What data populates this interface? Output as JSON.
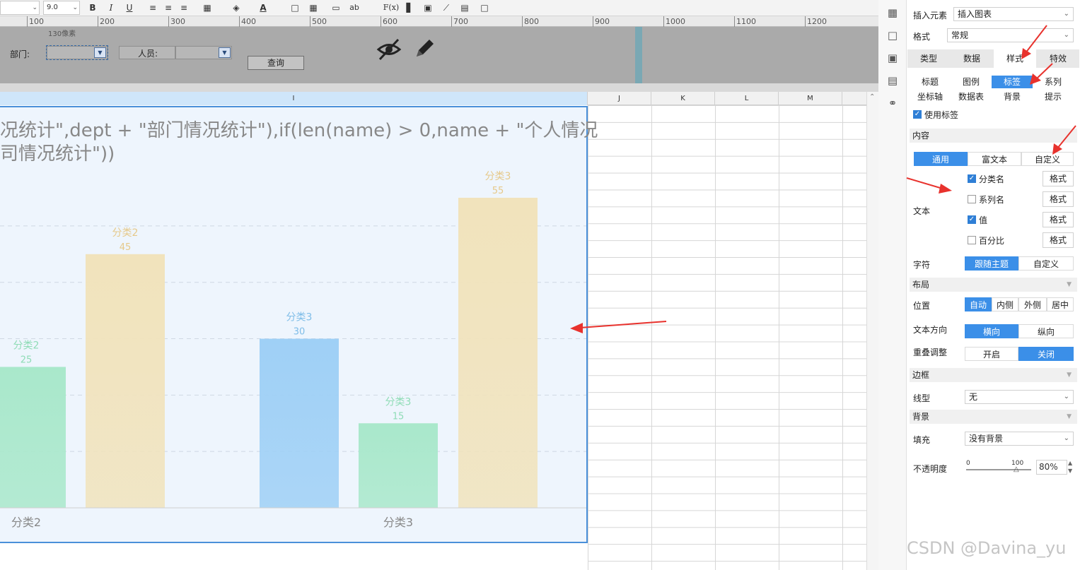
{
  "toolbar": {
    "font_size": "9.0",
    "bold": "B",
    "italic": "I",
    "underline": "U",
    "formula": "F(x)",
    "ab": "ab"
  },
  "ruler": {
    "labels": [
      "100",
      "200",
      "300",
      "400",
      "500",
      "600",
      "700",
      "800",
      "900",
      "1000",
      "1100",
      "1200"
    ],
    "pixel_hint": "130像素"
  },
  "param_panel": {
    "dept_label": "部门:",
    "person_label": "人员:",
    "query_button": "查询"
  },
  "columns": [
    "I",
    "J",
    "K",
    "L",
    "M"
  ],
  "chart": {
    "title_line1": "况统计\",dept + \"部门情况统计\"),if(len(name) > 0,name + \"个人情况",
    "title_line2": "司情况统计\"))"
  },
  "chart_data": {
    "type": "bar",
    "categories": [
      "分类2",
      "分类3"
    ],
    "ylim": [
      0,
      55
    ],
    "bars": [
      {
        "group": "分类2",
        "label": "分类2",
        "value": 25,
        "color": "#a9e8cb"
      },
      {
        "group": "分类2",
        "label": "分类2",
        "value": 45,
        "color": "#f1e3bc"
      },
      {
        "group": "分类3",
        "label": "分类3",
        "value": 30,
        "color": "#9fd0f6"
      },
      {
        "group": "分类3",
        "label": "分类3",
        "value": 15,
        "color": "#a9e8cb"
      },
      {
        "group": "分类3",
        "label": "分类3",
        "value": 55,
        "color": "#f1e3bc"
      }
    ]
  },
  "right_panel": {
    "insert_label": "插入元素",
    "insert_value": "插入图表",
    "format_label": "格式",
    "format_value": "常规",
    "tabs": [
      "类型",
      "数据",
      "样式",
      "特效"
    ],
    "subtabs_row1": [
      "标题",
      "图例",
      "标签",
      "系列"
    ],
    "subtabs_row2": [
      "坐标轴",
      "数据表",
      "背景",
      "提示"
    ],
    "use_label": "使用标签",
    "content_section": "内容",
    "content_modes": [
      "通用",
      "富文本",
      "自定义"
    ],
    "text_label": "文本",
    "text_options": [
      {
        "label": "分类名",
        "checked": true,
        "button": "格式"
      },
      {
        "label": "系列名",
        "checked": false,
        "button": "格式"
      },
      {
        "label": "值",
        "checked": true,
        "button": "格式"
      },
      {
        "label": "百分比",
        "checked": false,
        "button": "格式"
      }
    ],
    "char_label": "字符",
    "char_modes": [
      "跟随主题",
      "自定义"
    ],
    "layout_section": "布局",
    "position_label": "位置",
    "position_modes": [
      "自动",
      "内侧",
      "外侧",
      "居中"
    ],
    "direction_label": "文本方向",
    "direction_modes": [
      "横向",
      "纵向"
    ],
    "overlap_label": "重叠调整",
    "overlap_modes": [
      "开启",
      "关闭"
    ],
    "border_section": "边框",
    "linetype_label": "线型",
    "linetype_value": "无",
    "bg_section": "背景",
    "fill_label": "填充",
    "fill_value": "没有背景",
    "opacity_label": "不透明度",
    "opacity_min": "0",
    "opacity_max": "100",
    "opacity_value": "80%"
  },
  "watermark": "CSDN @Davina_yu",
  "colors": {
    "accent": "#3b8fe8",
    "annotation": "#e8322d",
    "chart_border": "#4a90d9"
  }
}
